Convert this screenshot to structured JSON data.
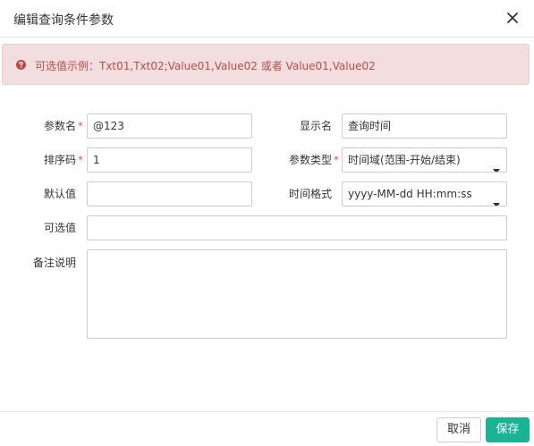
{
  "dialog": {
    "title": "编辑查询条件参数"
  },
  "alert": {
    "text": "可选值示例：Txt01,Txt02;Value01,Value02 或者 Value01,Value02",
    "icon": "question-circle-icon",
    "color": "#b94a48"
  },
  "form": {
    "param_name": {
      "label": "参数名",
      "required": "*",
      "value": "@123"
    },
    "display_name": {
      "label": "显示名",
      "value": "查询时间"
    },
    "sort_code": {
      "label": "排序码",
      "required": "*",
      "value": "1"
    },
    "param_type": {
      "label": "参数类型",
      "required": "*",
      "selected": "时间域(范围-开始/结束)"
    },
    "default_value": {
      "label": "默认值",
      "value": ""
    },
    "time_format": {
      "label": "时间格式",
      "selected": "yyyy-MM-dd HH:mm:ss"
    },
    "options": {
      "label": "可选值",
      "value": ""
    },
    "remarks": {
      "label": "备注说明",
      "value": ""
    }
  },
  "footer": {
    "cancel_label": "取消",
    "save_label": "保存",
    "save_color": "#1ab394"
  }
}
